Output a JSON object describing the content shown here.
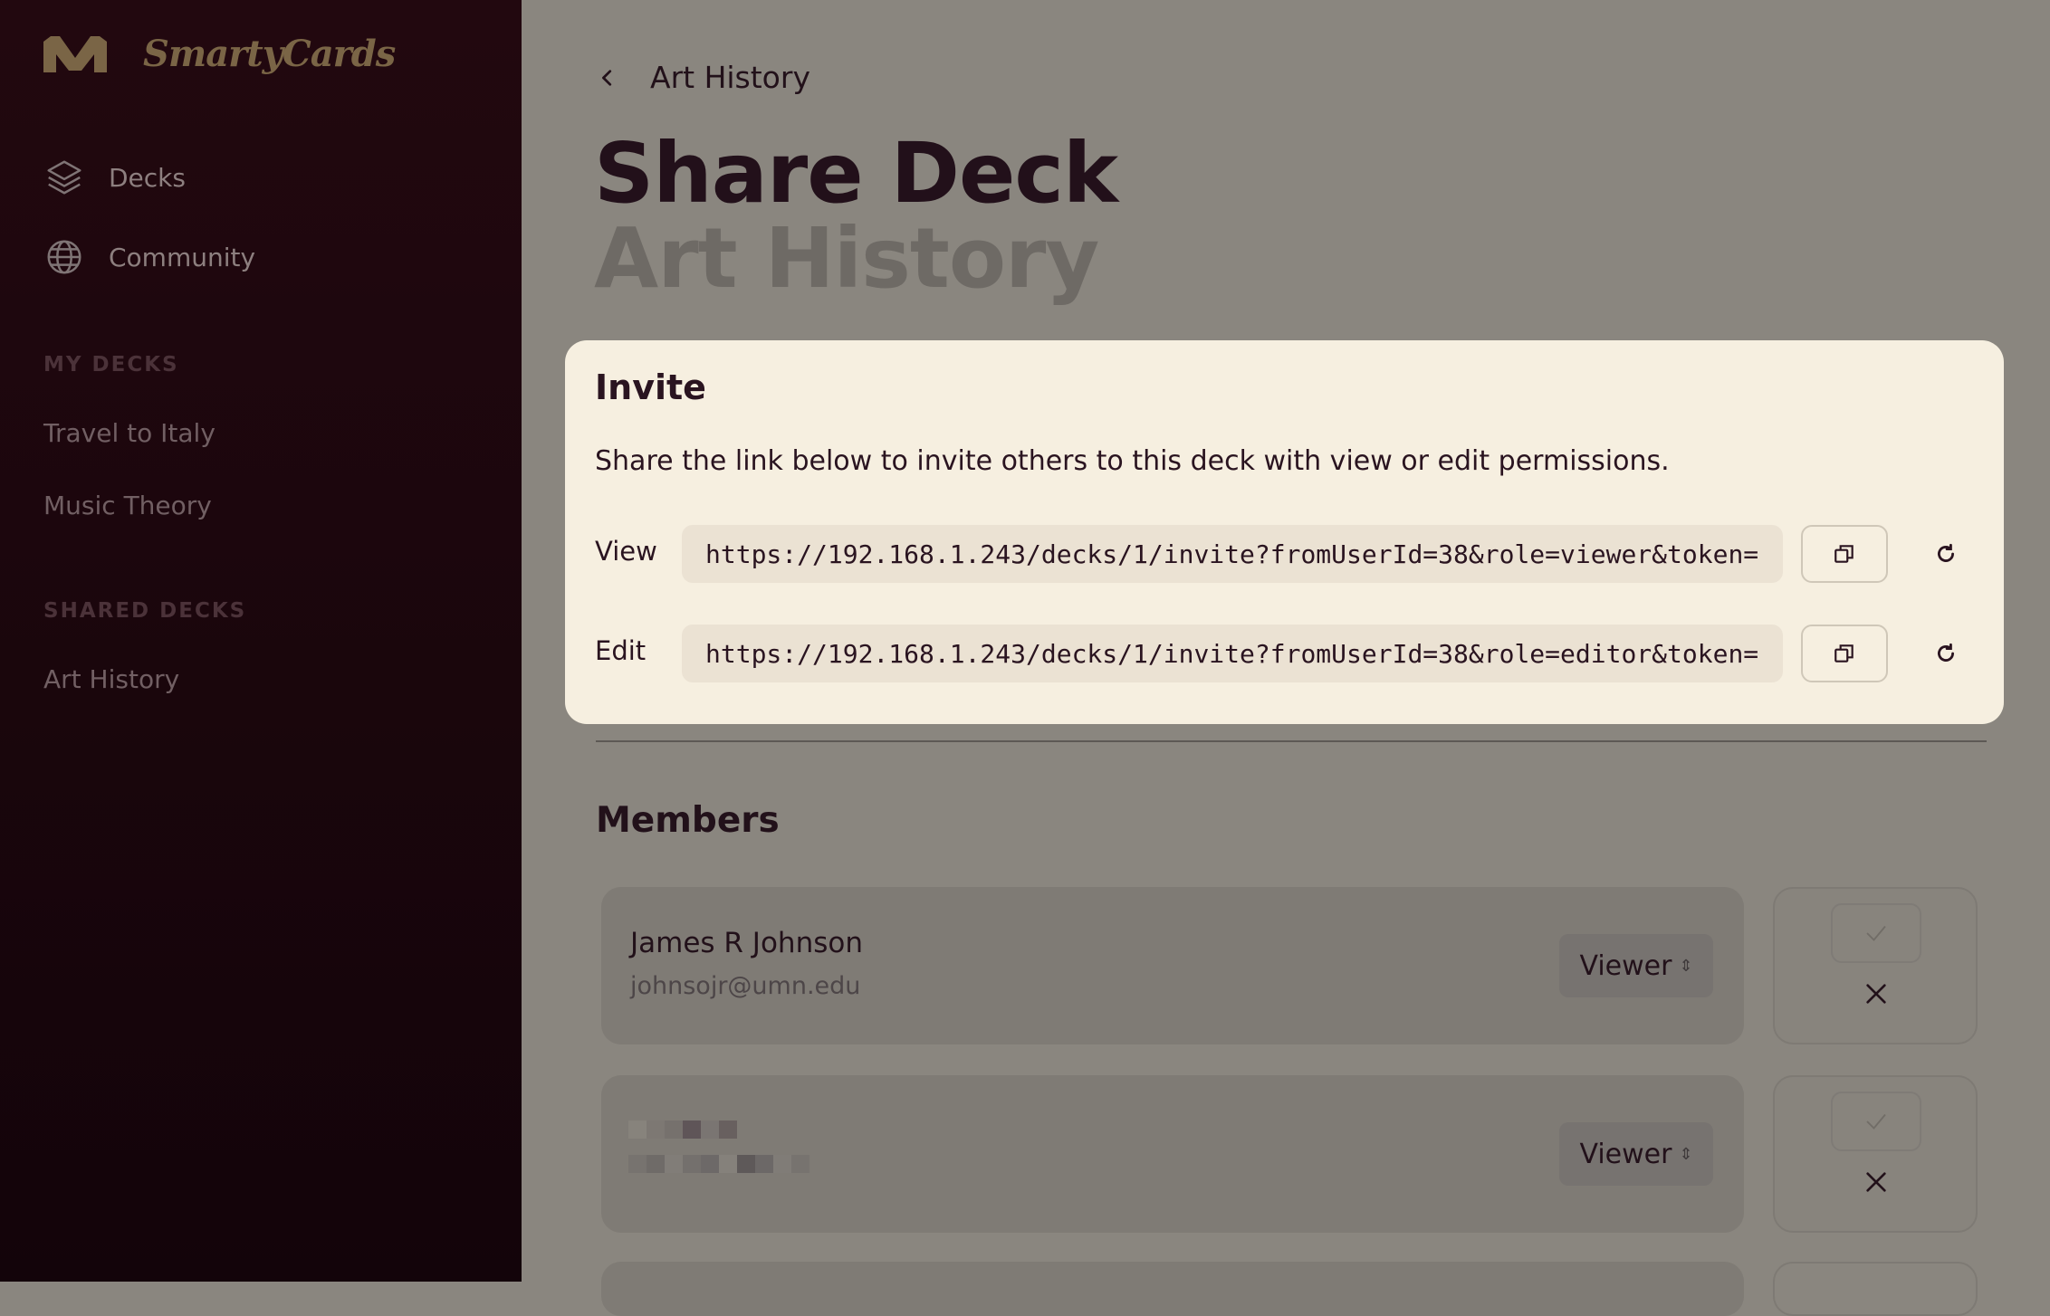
{
  "app": {
    "brand": "SmartyCards"
  },
  "sidebar": {
    "nav": [
      {
        "label": "Decks",
        "icon": "layers-icon"
      },
      {
        "label": "Community",
        "icon": "globe-icon"
      }
    ],
    "my_decks_heading": "MY DECKS",
    "my_decks": [
      "Travel to Italy",
      "Music Theory"
    ],
    "shared_decks_heading": "SHARED DECKS",
    "shared_decks": [
      "Art History"
    ]
  },
  "header": {
    "breadcrumb": "Art History",
    "title": "Share Deck",
    "subtitle": "Art History"
  },
  "invite": {
    "title": "Invite",
    "description": "Share the link below to invite others to this deck with view or edit permissions.",
    "view_label": "View",
    "view_link": "https://192.168.1.243/decks/1/invite?fromUserId=38&role=viewer&token=...",
    "edit_label": "Edit",
    "edit_link": "https://192.168.1.243/decks/1/invite?fromUserId=38&role=editor&token=..."
  },
  "members": {
    "title": "Members",
    "list": [
      {
        "name": "James R Johnson",
        "email": "johnsojr@umn.edu",
        "role": "Viewer"
      },
      {
        "name": "",
        "email": "",
        "role": "Viewer"
      }
    ]
  },
  "colors": {
    "sidebar_bg": "#1a060d",
    "accent_gold": "#7a6546",
    "modal_bg": "#f6efe0",
    "overlay_bg": "#8a867f",
    "text_dark": "#22111a"
  }
}
